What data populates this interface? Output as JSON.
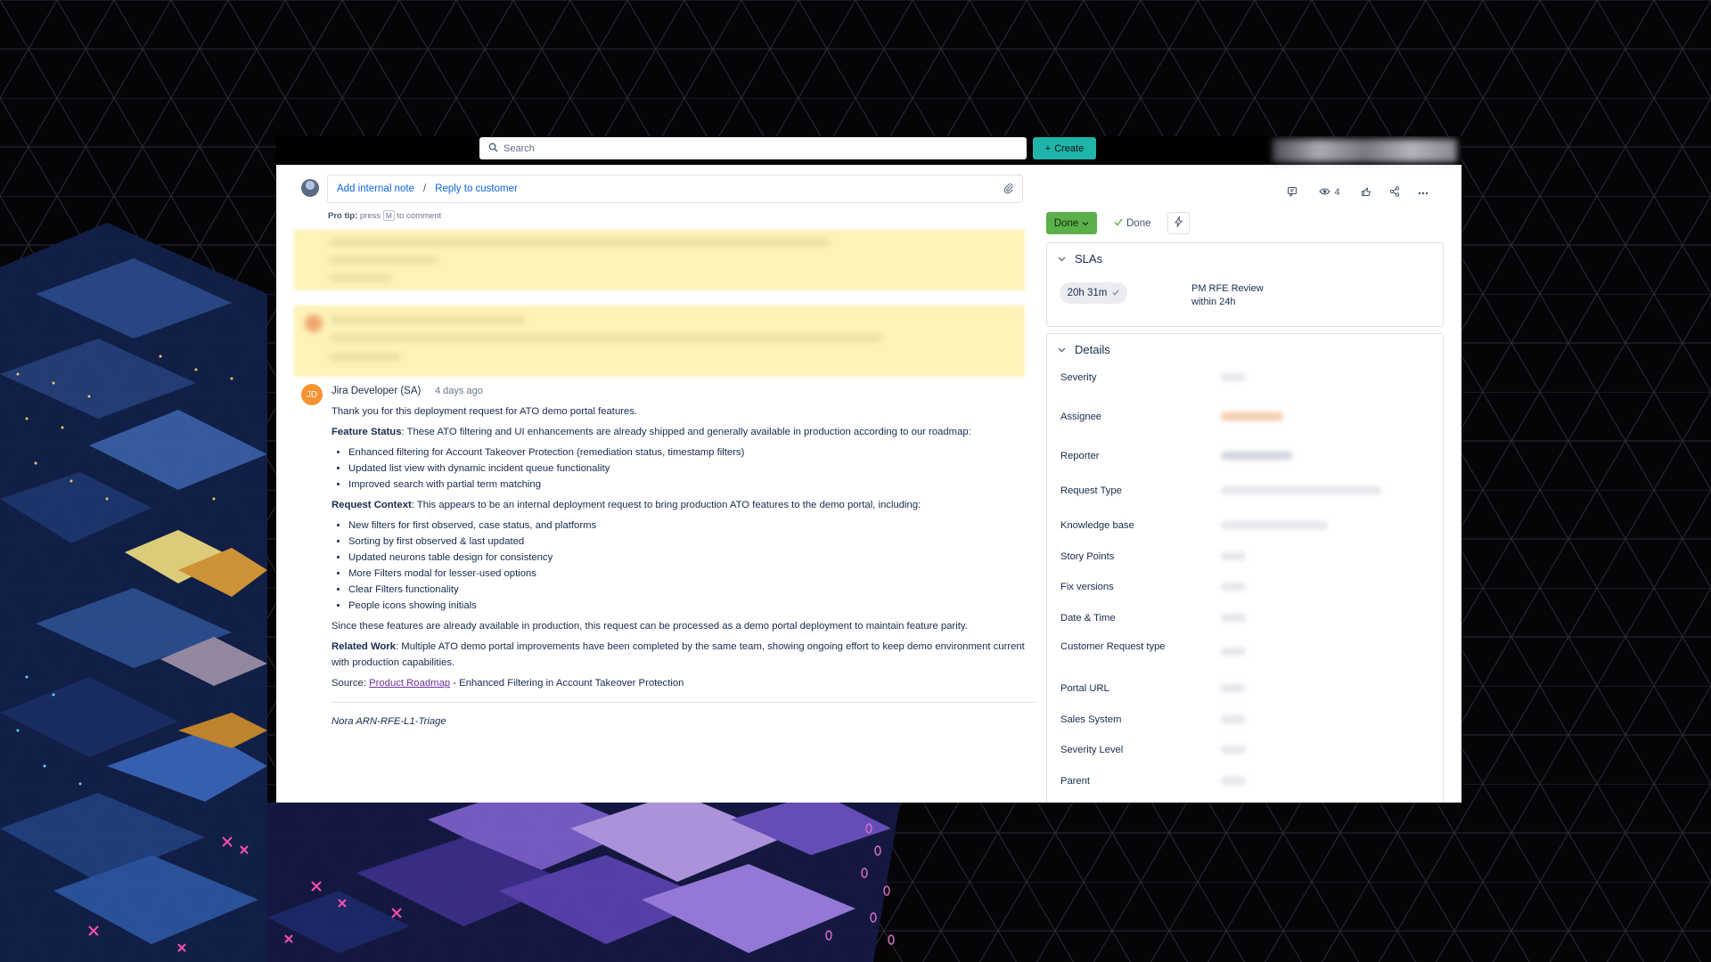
{
  "topbar": {
    "search_placeholder": "Search",
    "create_label": "Create"
  },
  "reply": {
    "add_note": "Add internal note",
    "separator": "/",
    "reply_customer": "Reply to customer",
    "pro_tip_prefix": "Pro tip:",
    "pro_tip_press": "press",
    "pro_tip_key": "M",
    "pro_tip_suffix": "to comment"
  },
  "comment": {
    "avatar_initials": "JD",
    "author": "Jira Developer (SA)",
    "time": "4 days ago",
    "intro": "Thank you for this deployment request for ATO demo portal features.",
    "feature_status_label": "Feature Status",
    "feature_status_text": ": These ATO filtering and UI enhancements are already shipped and generally available in production according to our roadmap:",
    "feature_items": [
      "Enhanced filtering for Account Takeover Protection (remediation status, timestamp filters)",
      "Updated list view with dynamic incident queue functionality",
      "Improved search with partial term matching"
    ],
    "request_context_label": "Request Context",
    "request_context_text": ": This appears to be an internal deployment request to bring production ATO features to the demo portal, including:",
    "context_items": [
      "New filters for first observed, case status, and platforms",
      "Sorting by first observed & last updated",
      "Updated neurons table design for consistency",
      "More Filters modal for lesser-used options",
      "Clear Filters functionality",
      "People icons showing initials"
    ],
    "since_text": "Since these features are already available in production, this request can be processed as a demo portal deployment to maintain feature parity.",
    "related_work_label": "Related Work",
    "related_work_text": ": Multiple ATO demo portal improvements have been completed by the same team, showing ongoing effort to keep demo environment current with production capabilities.",
    "source_prefix": "Source: ",
    "source_link": "Product Roadmap",
    "source_suffix": " - Enhanced Filtering in Account Takeover Protection",
    "signature": "Nora ARN-RFE-L1-Triage"
  },
  "toolbar": {
    "watch_count": "4"
  },
  "status": {
    "status_label": "Done",
    "resolution_label": "Done"
  },
  "slas": {
    "title": "SLAs",
    "chip_time": "20h 31m",
    "name_line1": "PM RFE Review",
    "name_line2": "within 24h"
  },
  "details": {
    "title": "Details",
    "fields": [
      "Severity",
      "Assignee",
      "Reporter",
      "Request Type",
      "Knowledge base",
      "Story Points",
      "Fix versions",
      "Date & Time",
      "Customer Request type",
      "Portal URL",
      "Sales System",
      "Severity Level",
      "Parent"
    ]
  },
  "colors": {
    "accent_create": "#1fb5aa",
    "status_done": "#5cb04a",
    "link": "#0c66e4",
    "avatar_jd": "#f79232"
  }
}
